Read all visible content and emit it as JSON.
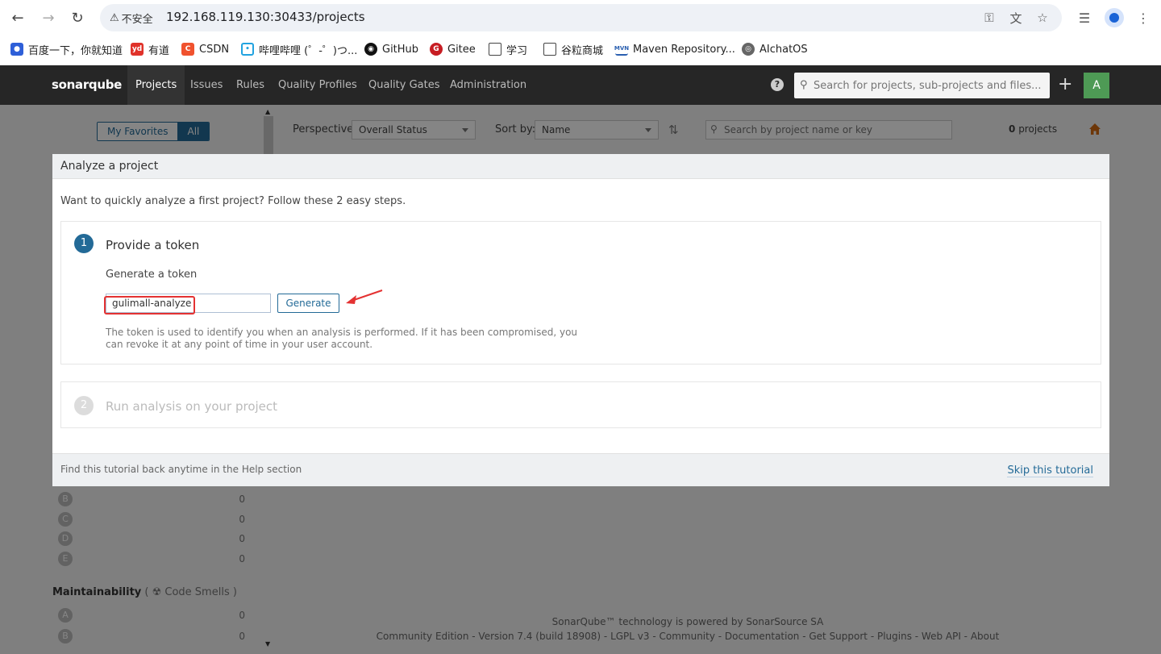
{
  "browser": {
    "security_label": "不安全",
    "url": "192.168.119.130:30433/projects",
    "bookmarks": [
      {
        "label": "百度一下，你就知道",
        "icon": "baidu-icon"
      },
      {
        "label": "有道",
        "icon": "youdao-icon"
      },
      {
        "label": "CSDN",
        "icon": "csdn-icon"
      },
      {
        "label": "哔哩哔哩 (゜-゜)つ...",
        "icon": "bilibili-icon"
      },
      {
        "label": "GitHub",
        "icon": "github-icon"
      },
      {
        "label": "Gitee",
        "icon": "gitee-icon"
      },
      {
        "label": "学习",
        "icon": "folder-icon"
      },
      {
        "label": "谷粒商城",
        "icon": "folder-icon"
      },
      {
        "label": "Maven Repository...",
        "icon": "maven-icon"
      },
      {
        "label": "AIchatOS",
        "icon": "globe-icon"
      }
    ]
  },
  "sonar": {
    "logo": "sonarqube",
    "nav": [
      "Projects",
      "Issues",
      "Rules",
      "Quality Profiles",
      "Quality Gates",
      "Administration"
    ],
    "search_placeholder": "Search for projects, sub-projects and files...",
    "user_initial": "A",
    "filter_toggle": {
      "favorites": "My Favorites",
      "all": "All"
    },
    "perspective_label": "Perspective:",
    "perspective_value": "Overall Status",
    "sort_label": "Sort by:",
    "sort_value": "Name",
    "project_search_placeholder": "Search by project name or key",
    "project_count_num": "0",
    "project_count_word": "projects",
    "reliability_rows": [
      {
        "grade": "B",
        "count": "0"
      },
      {
        "grade": "C",
        "count": "0"
      },
      {
        "grade": "D",
        "count": "0"
      },
      {
        "grade": "E",
        "count": "0"
      }
    ],
    "maintainability_title": "Maintainability",
    "maintainability_sub": "( ☢ Code Smells )",
    "maintainability_rows": [
      {
        "grade": "A",
        "count": "0"
      },
      {
        "grade": "B",
        "count": "0"
      }
    ],
    "footer_line1": "SonarQube™ technology is powered by SonarSource SA",
    "footer_line2": "Community Edition - Version 7.4 (build 18908) - LGPL v3 - Community - Documentation - Get Support - Plugins - Web API - About"
  },
  "modal": {
    "title": "Analyze a project",
    "intro": "Want to quickly analyze a first project? Follow these 2 easy steps.",
    "step1_num": "1",
    "step1_title": "Provide a token",
    "generate_label": "Generate a token",
    "token_value": "gulimall-analyze",
    "generate_button": "Generate",
    "token_note": "The token is used to identify you when an analysis is performed. If it has been compromised, you can revoke it at any point of time in your user account.",
    "step2_num": "2",
    "step2_title": "Run analysis on your project",
    "footer_note": "Find this tutorial back anytime in the Help section",
    "skip_link": "Skip this tutorial"
  },
  "colors": {
    "accent": "#236a97",
    "highlight": "#e43232",
    "topbar": "#262626"
  }
}
